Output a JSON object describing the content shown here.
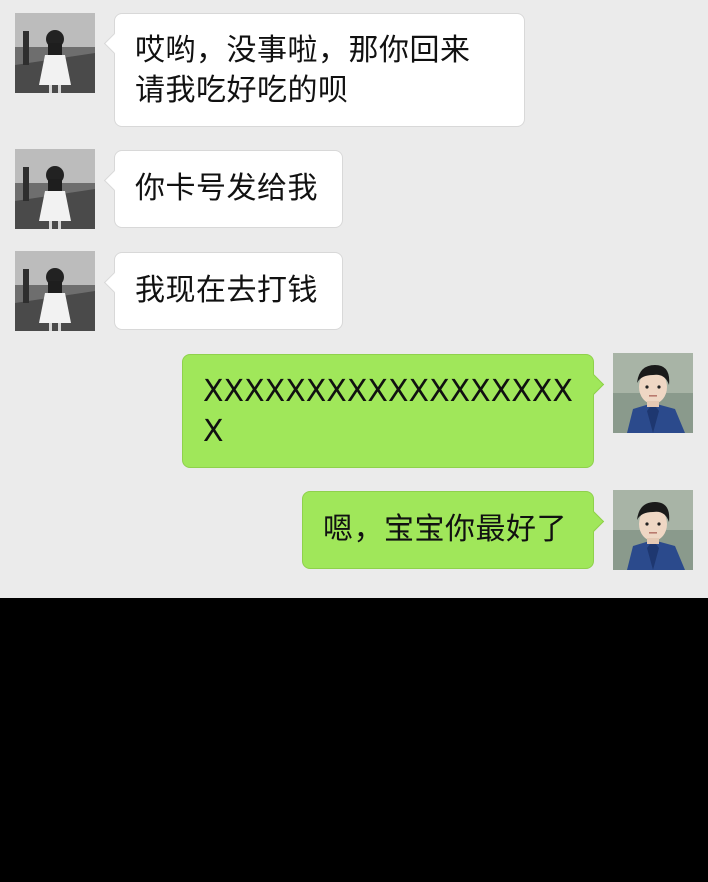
{
  "conversation": {
    "messages": [
      {
        "sender": "contact",
        "lines": [
          "哎哟，没事啦，那你回来",
          "请我吃好吃的呗"
        ]
      },
      {
        "sender": "contact",
        "lines": [
          "你卡号发给我"
        ]
      },
      {
        "sender": "contact",
        "lines": [
          "我现在去打钱"
        ]
      },
      {
        "sender": "me",
        "lines": [
          "XXXXXXXXXXXXXXXXXX",
          "X"
        ]
      },
      {
        "sender": "me",
        "lines": [
          "嗯，宝宝你最好了"
        ]
      }
    ]
  },
  "colors": {
    "chat_background": "#ebebeb",
    "incoming_bubble": "#ffffff",
    "outgoing_bubble": "#a0e75a",
    "below_chat": "#000000"
  },
  "icons": {
    "contact_avatar": "contact-avatar-photo",
    "my_avatar": "my-avatar-photo"
  }
}
